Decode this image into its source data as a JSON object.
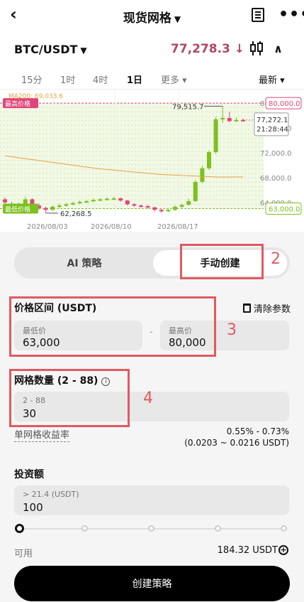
{
  "header": {
    "back_icon": "chevron-left-icon",
    "title": "现货网格",
    "caret": "▼",
    "more": "•••"
  },
  "pair": {
    "symbol": "BTC/USDT",
    "caret": "▼",
    "price": "77,278.3",
    "trend_arrow": "↓",
    "collapse": "∧",
    "price_color": "#b3466b"
  },
  "timeframes": {
    "items": [
      "15分",
      "1时",
      "4时",
      "1日",
      "更多 ▾"
    ],
    "active": "1日",
    "latest": "最新 ▾"
  },
  "chart_data": {
    "type": "candlestick",
    "ma_label": "MA200: 69,033.6",
    "high_tag": "最高价格",
    "low_tag": "最低价格",
    "high_line": 80000,
    "low_line": 63000,
    "high_box": "80,000.0",
    "low_box": "63,000.0",
    "current_price": "77,272.1",
    "countdown": "21:28:44",
    "peak_label": "79,515.7",
    "trough_label": "62,268.5",
    "y_ticks": [
      "80,000.0",
      "76,000.0",
      "72,000.0",
      "68,000.0",
      "64,000.0"
    ],
    "y_values": [
      80000,
      76000,
      72000,
      68000,
      64000
    ],
    "x_ticks": [
      "2026/08/03",
      "2026/08/10",
      "2026/08/17"
    ],
    "ylim": [
      61800,
      81500
    ],
    "candles": [
      {
        "o": 64500,
        "c": 64000,
        "h": 64800,
        "l": 63500
      },
      {
        "o": 63800,
        "c": 63300,
        "h": 64100,
        "l": 63000
      },
      {
        "o": 63300,
        "c": 63700,
        "h": 64000,
        "l": 63000
      },
      {
        "o": 63700,
        "c": 64500,
        "h": 64900,
        "l": 63500
      },
      {
        "o": 64500,
        "c": 63500,
        "h": 64700,
        "l": 63200
      },
      {
        "o": 63500,
        "c": 63100,
        "h": 63800,
        "l": 62800
      },
      {
        "o": 63100,
        "c": 62800,
        "h": 63300,
        "l": 62300
      },
      {
        "o": 62800,
        "c": 63300,
        "h": 63500,
        "l": 62600
      },
      {
        "o": 63300,
        "c": 63500,
        "h": 63800,
        "l": 63100
      },
      {
        "o": 63500,
        "c": 63700,
        "h": 63900,
        "l": 63300
      },
      {
        "o": 63700,
        "c": 63900,
        "h": 64100,
        "l": 63500
      },
      {
        "o": 63900,
        "c": 64100,
        "h": 64300,
        "l": 63700
      },
      {
        "o": 64100,
        "c": 64200,
        "h": 64400,
        "l": 63900
      },
      {
        "o": 64200,
        "c": 64400,
        "h": 64600,
        "l": 64000
      },
      {
        "o": 64400,
        "c": 64500,
        "h": 64700,
        "l": 64200
      },
      {
        "o": 64500,
        "c": 64600,
        "h": 64800,
        "l": 64300
      },
      {
        "o": 64600,
        "c": 64650,
        "h": 64900,
        "l": 64400
      },
      {
        "o": 64650,
        "c": 64300,
        "h": 64800,
        "l": 64100
      },
      {
        "o": 64300,
        "c": 63700,
        "h": 64400,
        "l": 63500
      },
      {
        "o": 63700,
        "c": 63500,
        "h": 63900,
        "l": 63300
      },
      {
        "o": 63500,
        "c": 63400,
        "h": 63700,
        "l": 63200
      },
      {
        "o": 63400,
        "c": 63200,
        "h": 63600,
        "l": 63000
      },
      {
        "o": 63200,
        "c": 62800,
        "h": 63300,
        "l": 62500
      },
      {
        "o": 62800,
        "c": 62600,
        "h": 63000,
        "l": 62300
      },
      {
        "o": 62600,
        "c": 62800,
        "h": 63000,
        "l": 62400
      },
      {
        "o": 62800,
        "c": 63300,
        "h": 63500,
        "l": 62600
      },
      {
        "o": 63300,
        "c": 63600,
        "h": 63800,
        "l": 63100
      },
      {
        "o": 63600,
        "c": 64200,
        "h": 64600,
        "l": 63500
      },
      {
        "o": 64200,
        "c": 67300,
        "h": 67600,
        "l": 64100
      },
      {
        "o": 67300,
        "c": 69500,
        "h": 69900,
        "l": 67100
      },
      {
        "o": 69500,
        "c": 72100,
        "h": 72400,
        "l": 69200
      },
      {
        "o": 72100,
        "c": 77400,
        "h": 77800,
        "l": 71800
      },
      {
        "o": 77400,
        "c": 77600,
        "h": 79515,
        "l": 76800
      },
      {
        "o": 77600,
        "c": 77100,
        "h": 78600,
        "l": 76900
      },
      {
        "o": 77100,
        "c": 77300,
        "h": 77700,
        "l": 76900
      },
      {
        "o": 77300,
        "c": 77272,
        "h": 77500,
        "l": 77000
      }
    ],
    "ma_values": [
      71500,
      71350,
      71200,
      71050,
      70900,
      70750,
      70600,
      70450,
      70300,
      70150,
      70000,
      69850,
      69700,
      69550,
      69400,
      69300,
      69200,
      69100,
      69000,
      68900,
      68800,
      68700,
      68600,
      68500,
      68450,
      68400,
      68350,
      68300,
      68250,
      68200,
      68150,
      68100,
      68100,
      68100,
      68100,
      68100
    ],
    "colors": {
      "up": "#7cc11e",
      "down": "#e0457b",
      "ma": "#e8a33d",
      "band": "#cfe7a8",
      "high": "#e0457b",
      "low": "#7cc11e"
    }
  },
  "strategy_tabs": {
    "ai": "AI 策略",
    "manual": "手动创建"
  },
  "price_range": {
    "title": "价格区间 (USDT)",
    "clear": "清除参数",
    "min_placeholder": "最低价",
    "min_value": "63,000",
    "max_placeholder": "最高价",
    "max_value": "80,000",
    "separator": "-"
  },
  "grid_count": {
    "title": "网格数量 (2 - 88)",
    "info": "i",
    "placeholder": "2 - 88",
    "value": "30"
  },
  "yield": {
    "label": "单网格收益率",
    "pct": "0.55% - 0.73%",
    "usdt": "(0.0203 ~ 0.0216 USDT)"
  },
  "investment": {
    "title": "投资额",
    "placeholder": "> 21.4 (USDT)",
    "value": "100"
  },
  "available": {
    "label": "可用",
    "value": "184.32 USDT"
  },
  "create_button": "创建策略",
  "annotations": {
    "a2": "2",
    "a3": "3",
    "a4": "4",
    "color": "#e05a61"
  }
}
